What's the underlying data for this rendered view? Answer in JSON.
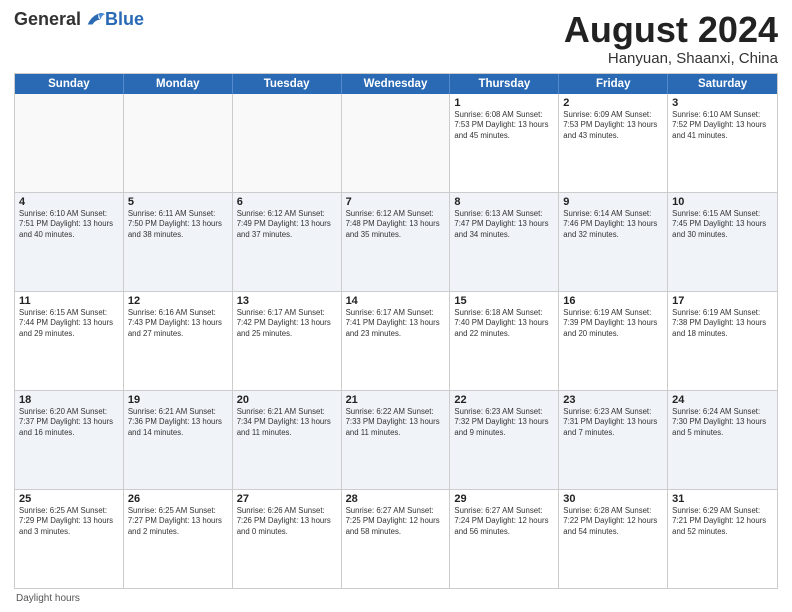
{
  "header": {
    "logo_general": "General",
    "logo_blue": "Blue",
    "month_title": "August 2024",
    "location": "Hanyuan, Shaanxi, China"
  },
  "day_headers": [
    "Sunday",
    "Monday",
    "Tuesday",
    "Wednesday",
    "Thursday",
    "Friday",
    "Saturday"
  ],
  "weeks": [
    {
      "days": [
        {
          "num": "",
          "info": "",
          "empty": true
        },
        {
          "num": "",
          "info": "",
          "empty": true
        },
        {
          "num": "",
          "info": "",
          "empty": true
        },
        {
          "num": "",
          "info": "",
          "empty": true
        },
        {
          "num": "1",
          "info": "Sunrise: 6:08 AM\nSunset: 7:53 PM\nDaylight: 13 hours\nand 45 minutes.",
          "empty": false
        },
        {
          "num": "2",
          "info": "Sunrise: 6:09 AM\nSunset: 7:53 PM\nDaylight: 13 hours\nand 43 minutes.",
          "empty": false
        },
        {
          "num": "3",
          "info": "Sunrise: 6:10 AM\nSunset: 7:52 PM\nDaylight: 13 hours\nand 41 minutes.",
          "empty": false
        }
      ]
    },
    {
      "days": [
        {
          "num": "4",
          "info": "Sunrise: 6:10 AM\nSunset: 7:51 PM\nDaylight: 13 hours\nand 40 minutes.",
          "empty": false
        },
        {
          "num": "5",
          "info": "Sunrise: 6:11 AM\nSunset: 7:50 PM\nDaylight: 13 hours\nand 38 minutes.",
          "empty": false
        },
        {
          "num": "6",
          "info": "Sunrise: 6:12 AM\nSunset: 7:49 PM\nDaylight: 13 hours\nand 37 minutes.",
          "empty": false
        },
        {
          "num": "7",
          "info": "Sunrise: 6:12 AM\nSunset: 7:48 PM\nDaylight: 13 hours\nand 35 minutes.",
          "empty": false
        },
        {
          "num": "8",
          "info": "Sunrise: 6:13 AM\nSunset: 7:47 PM\nDaylight: 13 hours\nand 34 minutes.",
          "empty": false
        },
        {
          "num": "9",
          "info": "Sunrise: 6:14 AM\nSunset: 7:46 PM\nDaylight: 13 hours\nand 32 minutes.",
          "empty": false
        },
        {
          "num": "10",
          "info": "Sunrise: 6:15 AM\nSunset: 7:45 PM\nDaylight: 13 hours\nand 30 minutes.",
          "empty": false
        }
      ]
    },
    {
      "days": [
        {
          "num": "11",
          "info": "Sunrise: 6:15 AM\nSunset: 7:44 PM\nDaylight: 13 hours\nand 29 minutes.",
          "empty": false
        },
        {
          "num": "12",
          "info": "Sunrise: 6:16 AM\nSunset: 7:43 PM\nDaylight: 13 hours\nand 27 minutes.",
          "empty": false
        },
        {
          "num": "13",
          "info": "Sunrise: 6:17 AM\nSunset: 7:42 PM\nDaylight: 13 hours\nand 25 minutes.",
          "empty": false
        },
        {
          "num": "14",
          "info": "Sunrise: 6:17 AM\nSunset: 7:41 PM\nDaylight: 13 hours\nand 23 minutes.",
          "empty": false
        },
        {
          "num": "15",
          "info": "Sunrise: 6:18 AM\nSunset: 7:40 PM\nDaylight: 13 hours\nand 22 minutes.",
          "empty": false
        },
        {
          "num": "16",
          "info": "Sunrise: 6:19 AM\nSunset: 7:39 PM\nDaylight: 13 hours\nand 20 minutes.",
          "empty": false
        },
        {
          "num": "17",
          "info": "Sunrise: 6:19 AM\nSunset: 7:38 PM\nDaylight: 13 hours\nand 18 minutes.",
          "empty": false
        }
      ]
    },
    {
      "days": [
        {
          "num": "18",
          "info": "Sunrise: 6:20 AM\nSunset: 7:37 PM\nDaylight: 13 hours\nand 16 minutes.",
          "empty": false
        },
        {
          "num": "19",
          "info": "Sunrise: 6:21 AM\nSunset: 7:36 PM\nDaylight: 13 hours\nand 14 minutes.",
          "empty": false
        },
        {
          "num": "20",
          "info": "Sunrise: 6:21 AM\nSunset: 7:34 PM\nDaylight: 13 hours\nand 11 minutes.",
          "empty": false
        },
        {
          "num": "21",
          "info": "Sunrise: 6:22 AM\nSunset: 7:33 PM\nDaylight: 13 hours\nand 11 minutes.",
          "empty": false
        },
        {
          "num": "22",
          "info": "Sunrise: 6:23 AM\nSunset: 7:32 PM\nDaylight: 13 hours\nand 9 minutes.",
          "empty": false
        },
        {
          "num": "23",
          "info": "Sunrise: 6:23 AM\nSunset: 7:31 PM\nDaylight: 13 hours\nand 7 minutes.",
          "empty": false
        },
        {
          "num": "24",
          "info": "Sunrise: 6:24 AM\nSunset: 7:30 PM\nDaylight: 13 hours\nand 5 minutes.",
          "empty": false
        }
      ]
    },
    {
      "days": [
        {
          "num": "25",
          "info": "Sunrise: 6:25 AM\nSunset: 7:29 PM\nDaylight: 13 hours\nand 3 minutes.",
          "empty": false
        },
        {
          "num": "26",
          "info": "Sunrise: 6:25 AM\nSunset: 7:27 PM\nDaylight: 13 hours\nand 2 minutes.",
          "empty": false
        },
        {
          "num": "27",
          "info": "Sunrise: 6:26 AM\nSunset: 7:26 PM\nDaylight: 13 hours\nand 0 minutes.",
          "empty": false
        },
        {
          "num": "28",
          "info": "Sunrise: 6:27 AM\nSunset: 7:25 PM\nDaylight: 12 hours\nand 58 minutes.",
          "empty": false
        },
        {
          "num": "29",
          "info": "Sunrise: 6:27 AM\nSunset: 7:24 PM\nDaylight: 12 hours\nand 56 minutes.",
          "empty": false
        },
        {
          "num": "30",
          "info": "Sunrise: 6:28 AM\nSunset: 7:22 PM\nDaylight: 12 hours\nand 54 minutes.",
          "empty": false
        },
        {
          "num": "31",
          "info": "Sunrise: 6:29 AM\nSunset: 7:21 PM\nDaylight: 12 hours\nand 52 minutes.",
          "empty": false
        }
      ]
    }
  ],
  "footer": {
    "note": "Daylight hours"
  }
}
